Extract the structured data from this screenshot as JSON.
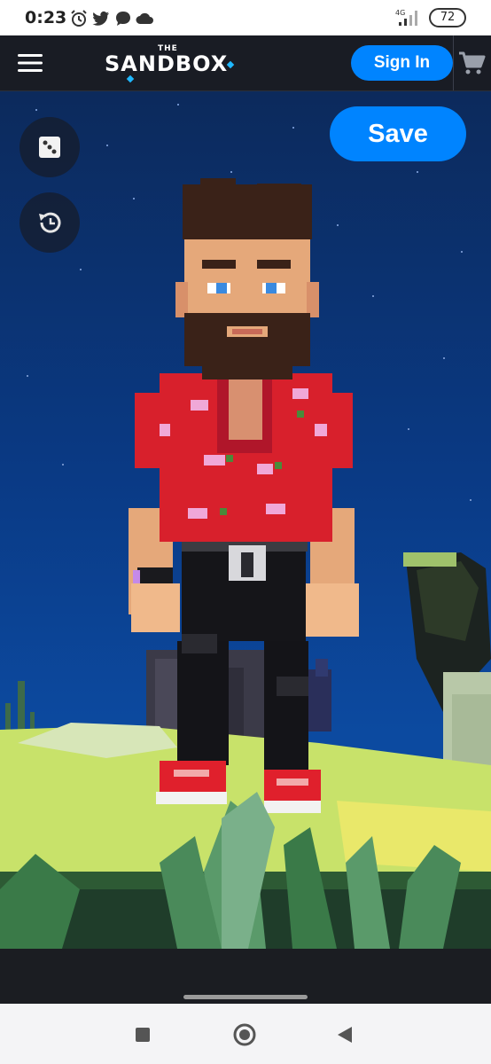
{
  "status_bar": {
    "time": "0:23",
    "network": "4G",
    "battery": "72",
    "icons": [
      "alarm-icon",
      "twitter-icon",
      "chat-bubble-icon",
      "cloud-icon",
      "signal-icon",
      "battery-icon"
    ]
  },
  "header": {
    "logo_top": "THE",
    "logo_word": "SANDBOX",
    "sign_in_label": "Sign In",
    "icons": [
      "hamburger-menu-icon",
      "cart-icon"
    ]
  },
  "editor": {
    "save_label": "Save",
    "tool_icons": [
      "dice-icon",
      "history-icon"
    ]
  },
  "system_nav": {
    "icons": [
      "recent-apps-icon",
      "home-icon",
      "back-icon"
    ]
  },
  "colors": {
    "brand_blue": "#0084ff",
    "header_bg": "#191c24",
    "sky": "#0a3a85",
    "shirt_red": "#d8202c",
    "grass": "#c8e26a"
  }
}
